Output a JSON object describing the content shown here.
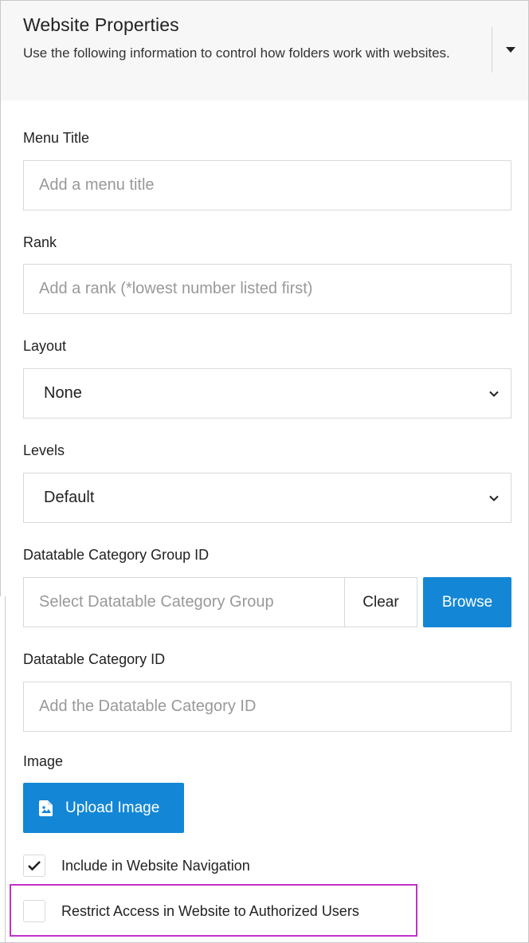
{
  "header": {
    "title": "Website Properties",
    "description": "Use the following information to control how folders work with websites.",
    "toggle_icon": "caret-down-icon"
  },
  "menu_title": {
    "label": "Menu Title",
    "value": "",
    "placeholder": "Add a menu title"
  },
  "rank": {
    "label": "Rank",
    "value": "",
    "placeholder": "Add a rank (*lowest number listed first)"
  },
  "layout": {
    "label": "Layout",
    "selected": "None"
  },
  "levels": {
    "label": "Levels",
    "selected": "Default"
  },
  "category_group": {
    "label": "Datatable Category Group ID",
    "placeholder": "Select Datatable Category Group",
    "clear_label": "Clear",
    "browse_label": "Browse"
  },
  "category_id": {
    "label": "Datatable Category ID",
    "placeholder": "Add the Datatable Category ID"
  },
  "image": {
    "label": "Image",
    "upload_label": "Upload Image",
    "upload_icon": "image-file-icon"
  },
  "options": [
    {
      "label": "Include in Website Navigation",
      "checked": true
    },
    {
      "label": "Restrict Access in Website to Authorized Users",
      "checked": false
    }
  ],
  "colors": {
    "primary_button": "#1387d6",
    "highlight_outline": "#c332c8",
    "header_background": "#f7f7f7"
  }
}
